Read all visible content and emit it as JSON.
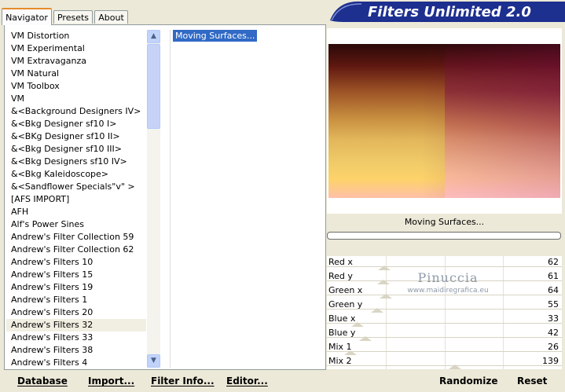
{
  "tabs": [
    "Navigator",
    "Presets",
    "About"
  ],
  "app": {
    "title": "Filters Unlimited 2.0"
  },
  "categories": [
    "VM Distortion",
    "VM Experimental",
    "VM Extravaganza",
    "VM Natural",
    "VM Toolbox",
    "VM",
    "&<Background Designers IV>",
    "&<Bkg Designer sf10 I>",
    "&<BKg Designer sf10 II>",
    "&<Bkg Designer sf10 III>",
    "&<Bkg Designers sf10 IV>",
    "&<Bkg Kaleidoscope>",
    "&<Sandflower Specials\"v\" >",
    "[AFS IMPORT]",
    "AFH",
    "Alf's Power Sines",
    "Andrew's Filter Collection 59",
    "Andrew's Filter Collection 62",
    "Andrew's Filters 10",
    "Andrew's Filters 15",
    "Andrew's Filters 19",
    "Andrew's Filters 1",
    "Andrew's Filters 20",
    "Andrew's Filters 32",
    "Andrew's Filters 33",
    "Andrew's Filters 38",
    "Andrew's Filters 4"
  ],
  "selected_category": "Andrew's Filters 32",
  "selected_filter": "Moving Surfaces...",
  "preview_label": "Moving Surfaces...",
  "progress": 0,
  "sliders": [
    {
      "label": "Red x",
      "value": "62",
      "level": 62
    },
    {
      "label": "Red y",
      "value": "61",
      "level": 61
    },
    {
      "label": "Green x",
      "value": "64",
      "level": 64
    },
    {
      "label": "Green y",
      "value": "55",
      "level": 55
    },
    {
      "label": "Blue x",
      "value": "33",
      "level": 33
    },
    {
      "label": "Blue y",
      "value": "42",
      "level": 42
    },
    {
      "label": "Mix 1",
      "value": "26",
      "level": 26
    },
    {
      "label": "Mix 2",
      "value": "139",
      "level": 139
    }
  ],
  "watermark": {
    "name": "Pinuccia",
    "url": "www.maidiregrafica.eu"
  },
  "buttons_left": {
    "database": "Database",
    "import": "Import...",
    "filter_info": "Filter Info...",
    "editor": "Editor..."
  },
  "buttons_right": {
    "randomize": "Randomize",
    "reset": "Reset"
  },
  "colors": {
    "selection": "#316ac5",
    "banner": "#1d2f8f",
    "tab_accent": "#e68b2c"
  }
}
